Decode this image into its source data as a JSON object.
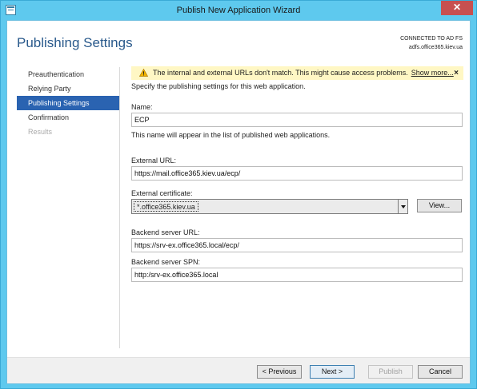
{
  "window": {
    "title": "Publish New Application Wizard",
    "close_glyph": "✕"
  },
  "header": {
    "page_title": "Publishing Settings",
    "connection_status": "CONNECTED TO AD FS",
    "connection_server": "adfs.office365.kiev.ua"
  },
  "nav": {
    "items": [
      {
        "label": "Preauthentication"
      },
      {
        "label": "Relying Party"
      },
      {
        "label": "Publishing Settings"
      },
      {
        "label": "Confirmation"
      },
      {
        "label": "Results"
      }
    ]
  },
  "warning": {
    "text": "The internal and external URLs don't match. This might cause access problems.",
    "link": "Show more...",
    "close": "×"
  },
  "form": {
    "description": "Specify the publishing settings for this web application.",
    "name_label": "Name:",
    "name_value": "ECP",
    "name_hint": "This name will appear in the list of published web applications.",
    "external_url_label": "External URL:",
    "external_url_value": "https://mail.office365.kiev.ua/ecp/",
    "external_cert_label": "External certificate:",
    "external_cert_value": "*.office365.kiev.ua",
    "view_button": "View...",
    "backend_url_label": "Backend server URL:",
    "backend_url_value": "https://srv-ex.office365.local/ecp/",
    "backend_spn_label": "Backend server SPN:",
    "backend_spn_value": "http:/srv-ex.office365.local"
  },
  "footer": {
    "previous": "< Previous",
    "next": "Next >",
    "publish": "Publish",
    "cancel": "Cancel"
  }
}
